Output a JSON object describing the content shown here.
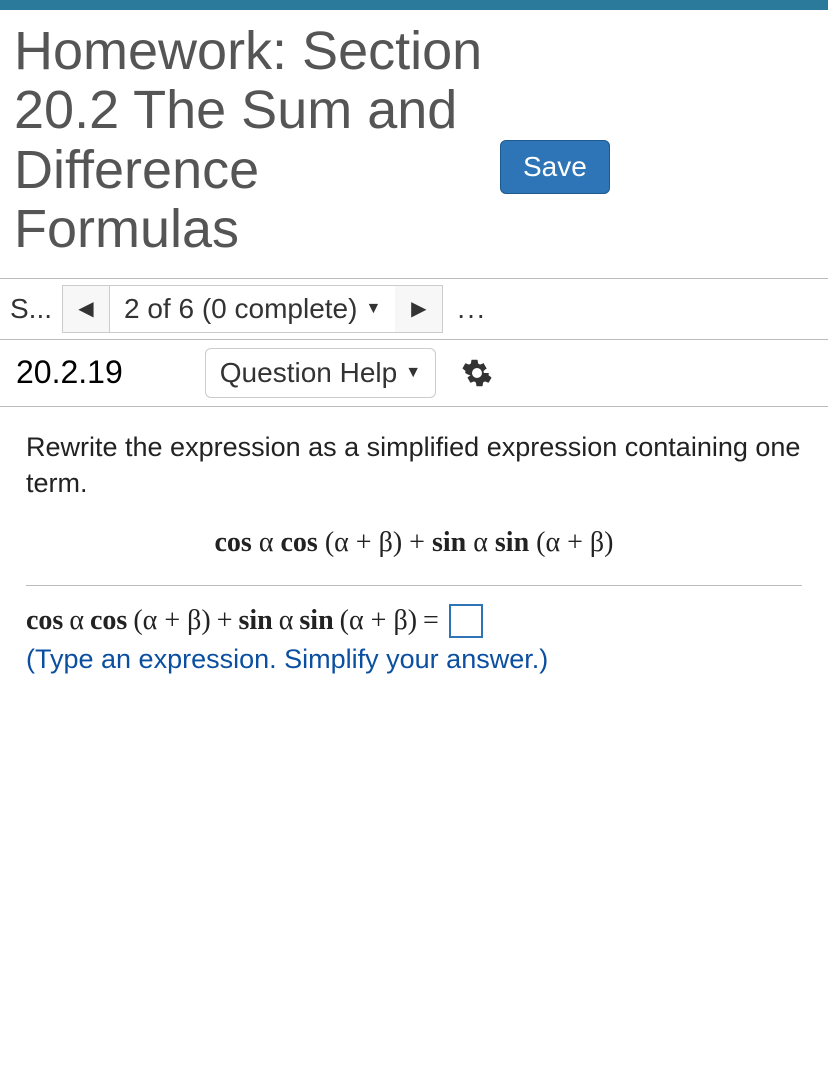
{
  "header": {
    "title": "Homework: Section 20.2 The Sum and Difference Formulas",
    "save_label": "Save"
  },
  "nav": {
    "score_label": "S...",
    "progress_text": "2 of 6 (0 complete)",
    "ellipsis": "..."
  },
  "question": {
    "number": "20.2.19",
    "help_label": "Question Help"
  },
  "content": {
    "instructions": "Rewrite the expression as a simplified expression containing one term.",
    "expr_cos": "cos",
    "expr_sin": "sin",
    "alpha": "α",
    "sum": "(α + β)",
    "plus": "+",
    "equals": "=",
    "hint": "(Type an expression. Simplify your answer.)"
  }
}
